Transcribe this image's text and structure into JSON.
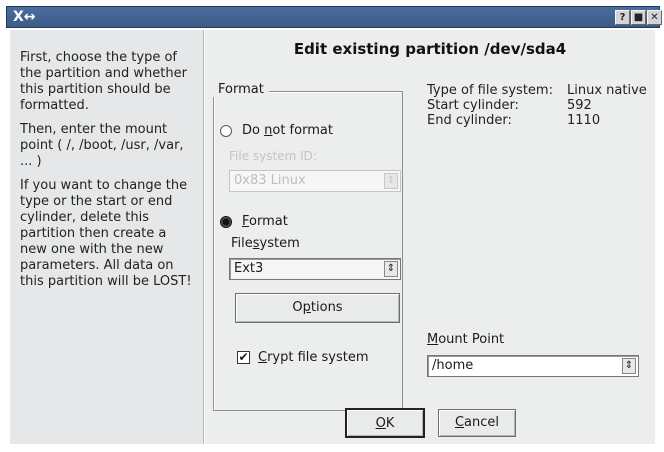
{
  "window": {
    "app_label": "X↔",
    "buttons": [
      "?",
      "■",
      "✕"
    ]
  },
  "help": {
    "paragraphs": [
      "First, choose the type of the partition and whether this partition should be formatted.",
      "Then, enter the mount point ( /, /boot, /usr, /var, ... )",
      "If you want to change the type or the start or end cylinder, delete this partition then create a new one with the new parameters. All data on this partition will be LOST!"
    ]
  },
  "dialog": {
    "title": "Edit existing partition /dev/sda4",
    "format_group": {
      "legend": "Format",
      "do_not_format_pre": "Do ",
      "do_not_format_ul": "n",
      "do_not_format_post": "ot format",
      "file_system_id_label": "File system ID:",
      "file_system_id_value": "0x83 Linux",
      "format_ul": "F",
      "format_post": "ormat",
      "filesystem_pre": "File",
      "filesystem_ul": "s",
      "filesystem_post": "ystem",
      "filesystem_value": "Ext3",
      "options_pre": "O",
      "options_ul": "p",
      "options_post": "tions",
      "crypt_ul": "C",
      "crypt_post": "rypt file system",
      "do_not_format_selected": false,
      "format_selected": true,
      "crypt_checked": true
    },
    "info": [
      {
        "key": "Type of file system:",
        "value": "Linux native"
      },
      {
        "key": "Start cylinder:",
        "value": "592"
      },
      {
        "key": "End cylinder:",
        "value": "1110"
      }
    ],
    "mount_point": {
      "label_ul": "M",
      "label_post": "ount Point",
      "value": "/home"
    },
    "ok": {
      "ul": "O",
      "post": "K"
    },
    "cancel": {
      "ul": "C",
      "post": "ancel"
    }
  }
}
